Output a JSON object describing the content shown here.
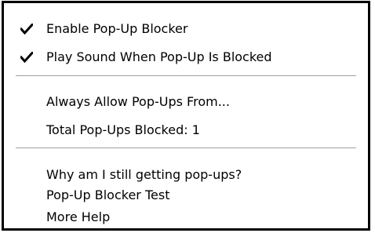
{
  "menu": {
    "items": [
      {
        "label": "Enable Pop-Up Blocker",
        "checked": true,
        "icon": "checkmark-icon"
      },
      {
        "label": "Play Sound When Pop-Up Is Blocked",
        "checked": true,
        "icon": "checkmark-icon"
      },
      {
        "label": "Always Allow Pop-Ups From...",
        "checked": false
      },
      {
        "label": "Total Pop-Ups Blocked: 1",
        "checked": false
      },
      {
        "label": "Why am I still getting pop-ups?",
        "checked": false
      },
      {
        "label": "Pop-Up Blocker Test",
        "checked": false
      },
      {
        "label": "More Help",
        "checked": false
      }
    ]
  }
}
